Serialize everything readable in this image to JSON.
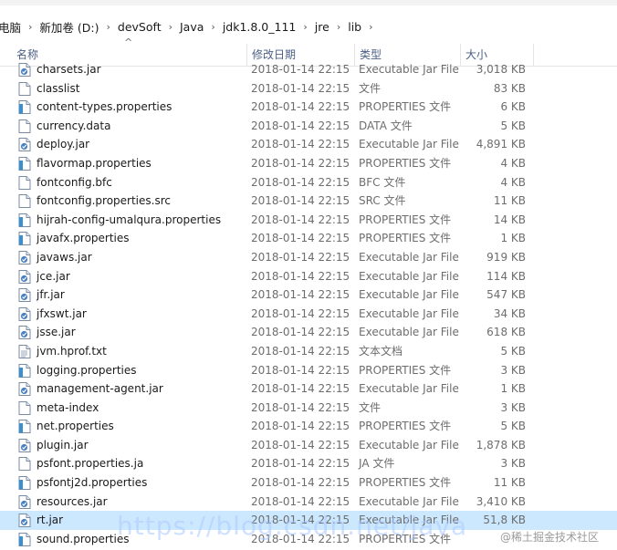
{
  "breadcrumb": [
    "电脑",
    "新加卷 (D:)",
    "devSoft",
    "Java",
    "jdk1.8.0_111",
    "jre",
    "lib"
  ],
  "columns": {
    "name": "名称",
    "date": "修改日期",
    "type": "类型",
    "size": "大小"
  },
  "files": [
    {
      "name": "charsets.jar",
      "date": "2018-01-14 22:15",
      "type": "Executable Jar File",
      "size": "3,018 KB",
      "icon": "jar"
    },
    {
      "name": "classlist",
      "date": "2018-01-14 22:15",
      "type": "文件",
      "size": "83 KB",
      "icon": "file"
    },
    {
      "name": "content-types.properties",
      "date": "2018-01-14 22:15",
      "type": "PROPERTIES 文件",
      "size": "6 KB",
      "icon": "properties"
    },
    {
      "name": "currency.data",
      "date": "2018-01-14 22:15",
      "type": "DATA 文件",
      "size": "5 KB",
      "icon": "file"
    },
    {
      "name": "deploy.jar",
      "date": "2018-01-14 22:15",
      "type": "Executable Jar File",
      "size": "4,891 KB",
      "icon": "jar"
    },
    {
      "name": "flavormap.properties",
      "date": "2018-01-14 22:15",
      "type": "PROPERTIES 文件",
      "size": "4 KB",
      "icon": "properties"
    },
    {
      "name": "fontconfig.bfc",
      "date": "2018-01-14 22:15",
      "type": "BFC 文件",
      "size": "4 KB",
      "icon": "file"
    },
    {
      "name": "fontconfig.properties.src",
      "date": "2018-01-14 22:15",
      "type": "SRC 文件",
      "size": "11 KB",
      "icon": "file"
    },
    {
      "name": "hijrah-config-umalqura.properties",
      "date": "2018-01-14 22:15",
      "type": "PROPERTIES 文件",
      "size": "14 KB",
      "icon": "properties"
    },
    {
      "name": "javafx.properties",
      "date": "2018-01-14 22:15",
      "type": "PROPERTIES 文件",
      "size": "1 KB",
      "icon": "properties"
    },
    {
      "name": "javaws.jar",
      "date": "2018-01-14 22:15",
      "type": "Executable Jar File",
      "size": "919 KB",
      "icon": "jar"
    },
    {
      "name": "jce.jar",
      "date": "2018-01-14 22:15",
      "type": "Executable Jar File",
      "size": "114 KB",
      "icon": "jar"
    },
    {
      "name": "jfr.jar",
      "date": "2018-01-14 22:15",
      "type": "Executable Jar File",
      "size": "547 KB",
      "icon": "jar"
    },
    {
      "name": "jfxswt.jar",
      "date": "2018-01-14 22:15",
      "type": "Executable Jar File",
      "size": "34 KB",
      "icon": "jar"
    },
    {
      "name": "jsse.jar",
      "date": "2018-01-14 22:15",
      "type": "Executable Jar File",
      "size": "618 KB",
      "icon": "jar"
    },
    {
      "name": "jvm.hprof.txt",
      "date": "2018-01-14 22:15",
      "type": "文本文档",
      "size": "5 KB",
      "icon": "text"
    },
    {
      "name": "logging.properties",
      "date": "2018-01-14 22:15",
      "type": "PROPERTIES 文件",
      "size": "3 KB",
      "icon": "properties"
    },
    {
      "name": "management-agent.jar",
      "date": "2018-01-14 22:15",
      "type": "Executable Jar File",
      "size": "1 KB",
      "icon": "jar"
    },
    {
      "name": "meta-index",
      "date": "2018-01-14 22:15",
      "type": "文件",
      "size": "3 KB",
      "icon": "file"
    },
    {
      "name": "net.properties",
      "date": "2018-01-14 22:15",
      "type": "PROPERTIES 文件",
      "size": "5 KB",
      "icon": "properties"
    },
    {
      "name": "plugin.jar",
      "date": "2018-01-14 22:15",
      "type": "Executable Jar File",
      "size": "1,878 KB",
      "icon": "jar"
    },
    {
      "name": "psfont.properties.ja",
      "date": "2018-01-14 22:15",
      "type": "JA 文件",
      "size": "3 KB",
      "icon": "file"
    },
    {
      "name": "psfontj2d.properties",
      "date": "2018-01-14 22:15",
      "type": "PROPERTIES 文件",
      "size": "11 KB",
      "icon": "properties"
    },
    {
      "name": "resources.jar",
      "date": "2018-01-14 22:15",
      "type": "Executable Jar File",
      "size": "3,410 KB",
      "icon": "jar"
    },
    {
      "name": "rt.jar",
      "date": "2018-01-14 22:15",
      "type": "Executable Jar File",
      "size": "51,8 KB",
      "icon": "jar",
      "selected": true
    },
    {
      "name": "sound.properties",
      "date": "2018-01-14 22:15",
      "type": "PROPERTIES 文件",
      "size": "",
      "icon": "properties"
    }
  ],
  "watermark": {
    "url": "https://blog.csdn.net/java",
    "site": "@稀土掘金技术社区"
  },
  "colors": {
    "selection": "#cce8ff",
    "header_text": "#4a5f85",
    "jar_icon": "#4a7fc1",
    "properties_icon": "#3a8fd0"
  }
}
